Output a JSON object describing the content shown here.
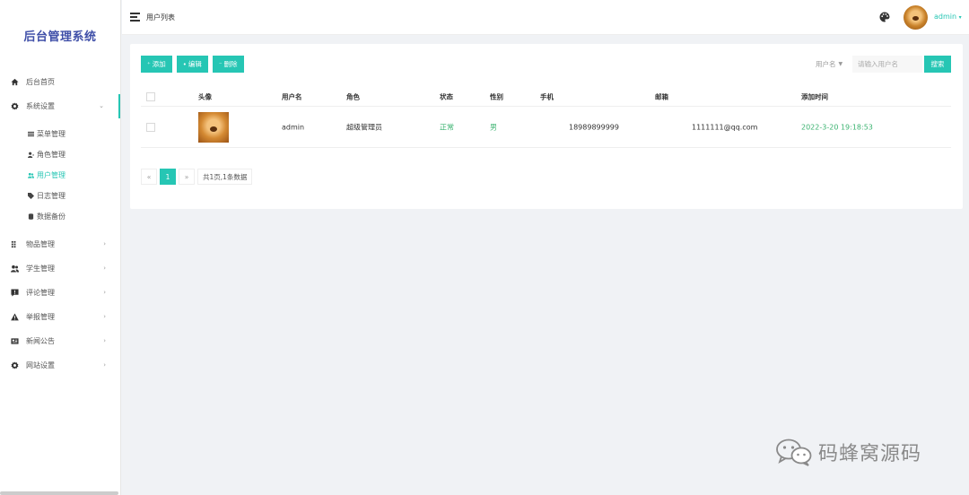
{
  "sidebar": {
    "brand": "后台管理系统",
    "items": [
      {
        "label": "后台首页",
        "icon": "home-icon"
      },
      {
        "label": "系统设置",
        "icon": "gear-icon",
        "expanded": true,
        "children": [
          {
            "label": "菜单管理",
            "icon": "list-icon"
          },
          {
            "label": "角色管理",
            "icon": "user-role-icon"
          },
          {
            "label": "用户管理",
            "icon": "users-icon",
            "active": true
          },
          {
            "label": "日志管理",
            "icon": "tag-icon"
          },
          {
            "label": "数据备份",
            "icon": "database-icon"
          }
        ]
      },
      {
        "label": "物品管理",
        "icon": "grid-icon"
      },
      {
        "label": "学生管理",
        "icon": "users-icon"
      },
      {
        "label": "评论管理",
        "icon": "comment-icon"
      },
      {
        "label": "举报管理",
        "icon": "warning-icon"
      },
      {
        "label": "新闻公告",
        "icon": "news-icon"
      },
      {
        "label": "网站设置",
        "icon": "gear-icon"
      }
    ]
  },
  "header": {
    "title": "用户列表",
    "username": "admin"
  },
  "toolbar": {
    "add_label": "添加",
    "edit_label": "编辑",
    "delete_label": "删除"
  },
  "search": {
    "field_label": "用户名",
    "placeholder": "请输入用户名",
    "button_label": "搜索"
  },
  "table": {
    "columns": [
      "头像",
      "用户名",
      "角色",
      "状态",
      "性别",
      "手机",
      "邮箱",
      "添加时间"
    ],
    "rows": [
      {
        "username": "admin",
        "role": "超级管理员",
        "status": "正常",
        "gender": "男",
        "phone": "18989899999",
        "email": "1111111@qq.com",
        "created": "2022-3-20 19:18:53"
      }
    ]
  },
  "pagination": {
    "prev": "«",
    "current": "1",
    "next": "»",
    "info": "共1页,1条数据"
  },
  "watermark": "码蜂窝源码",
  "colors": {
    "accent": "#26c6b4",
    "brand": "#3f4fa8"
  }
}
